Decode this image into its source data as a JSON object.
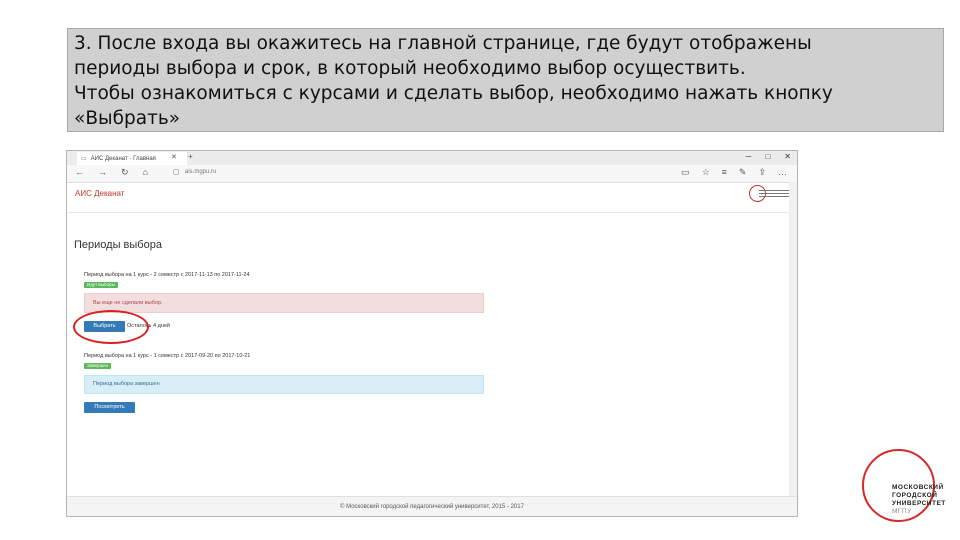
{
  "caption": {
    "lines": [
      "3. После входа вы окажитесь на главной странице, где будут отображены",
      "периоды выбора и срок, в который необходимо выбор осуществить.",
      "Чтобы ознакомиться с курсами и сделать выбор, необходимо нажать кнопку",
      "«Выбрать»"
    ]
  },
  "browser": {
    "tab_label": "АИС Деканат · Главная",
    "url": "ais.mgpu.ru"
  },
  "app": {
    "name": "АИС Деканат",
    "page_title": "Периоды выбора",
    "periods": [
      {
        "label": "Период выбора на 1 курс - 2 семестр с 2017-11-13 по 2017-11-24",
        "badge": "Идут выборы",
        "badge_color": "#5cb85c",
        "alert": "Вы еще не сделали выбор.",
        "button": "Выбрать",
        "remaining": "Осталось 4 дней"
      },
      {
        "label": "Период выбора на 1 курс - 1 семестр с 2017-09-20 по 2017-10-21",
        "badge": "Завершен",
        "badge_color": "#5cb85c",
        "alert": "Период выбора завершен",
        "button": "Посмотреть"
      }
    ],
    "footer": "© Московский городской педагогический университет, 2015 - 2017"
  },
  "logo": {
    "lines": [
      "МОСКОВСКИЙ",
      "ГОРОДСКОЙ",
      "УНИВЕРСИТЕТ",
      "МГПУ"
    ]
  },
  "colors": {
    "highlight_circle": "#d92020",
    "primary_button": "#337ab7",
    "app_name": "#c0392b"
  }
}
